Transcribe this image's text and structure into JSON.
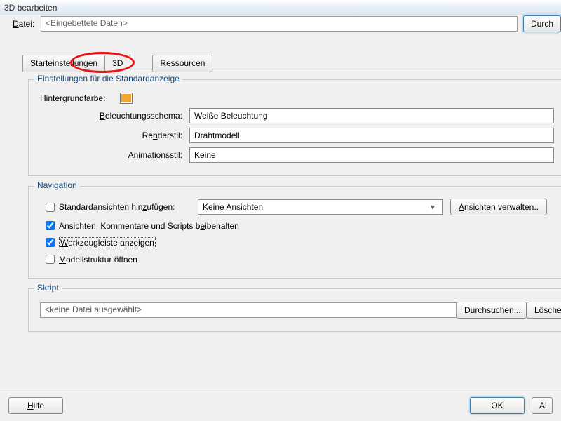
{
  "window": {
    "title": "3D bearbeiten"
  },
  "file": {
    "label": "Datei:",
    "value": "<Eingebettete Daten>",
    "browse": "Durch"
  },
  "tabs": {
    "t0": "Starteinstellungen",
    "t1": "3D",
    "t2": "Ressourcen"
  },
  "groups": {
    "display": {
      "legend": "Einstellungen für die Standardanzeige",
      "bgcolor_label": "Hintergrundfarbe:",
      "light_label": "Beleuchtungsschema:",
      "light_value": "Weiße Beleuchtung",
      "render_label": "Renderstil:",
      "render_value": "Drahtmodell",
      "anim_label": "Animationsstil:",
      "anim_value": "Keine"
    },
    "nav": {
      "legend": "Navigation",
      "addviews_label": "Standardansichten hinzufügen:",
      "addviews_value": "Keine Ansichten",
      "manage_btn": "Ansichten verwalten..",
      "keep_label": "Ansichten, Kommentare und Scripts beibehalten",
      "toolbar_label": "Werkzeugleiste anzeigen",
      "tree_label": "Modellstruktur öffnen"
    },
    "script": {
      "legend": "Skript",
      "value": "<keine Datei ausgewählt>",
      "browse": "Durchsuchen...",
      "clear": "Löschen"
    }
  },
  "footer": {
    "help": "Hilfe",
    "ok": "OK",
    "cancel": "Al"
  }
}
